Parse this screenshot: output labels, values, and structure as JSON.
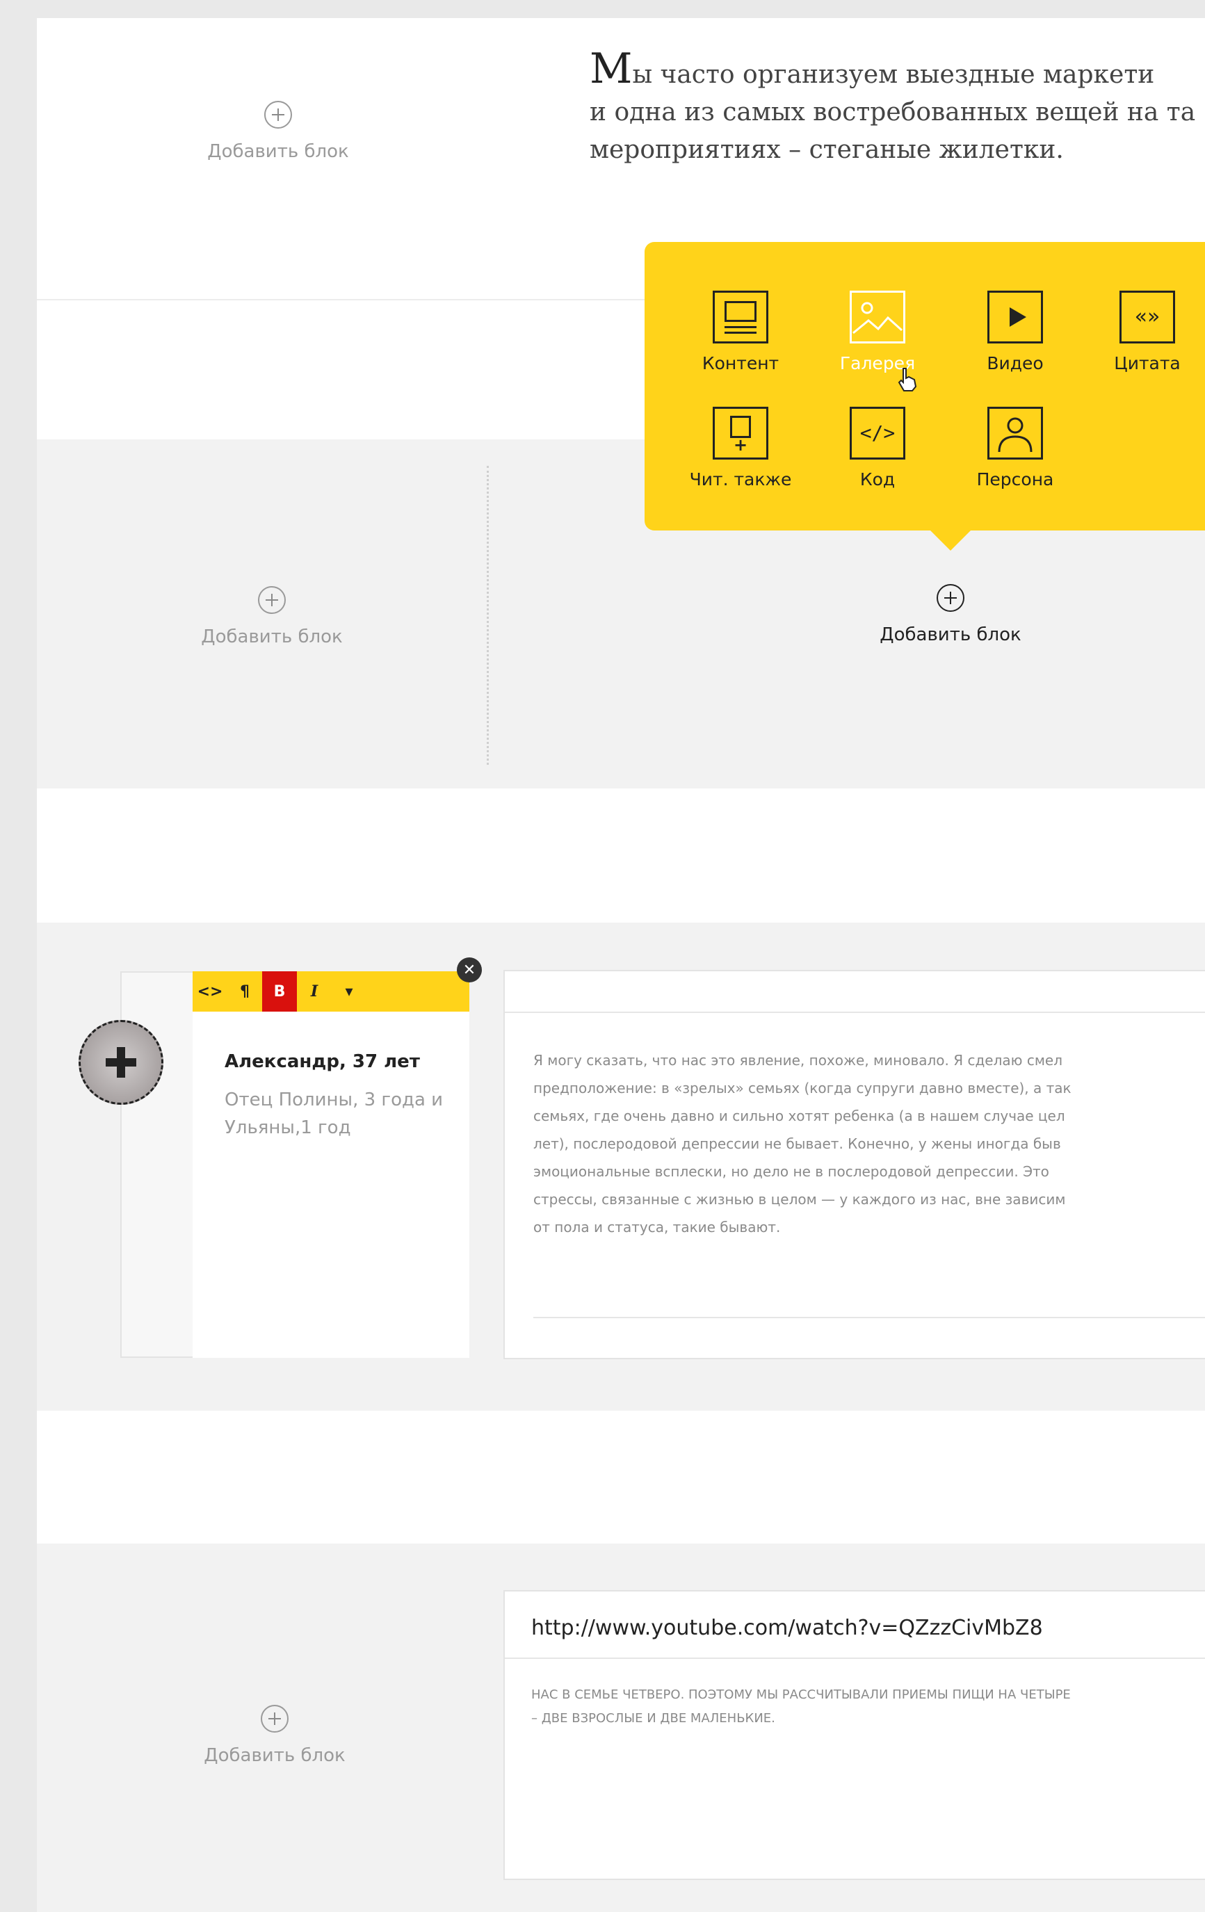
{
  "add_block_label": "Добавить блок",
  "intro": {
    "cap": "М",
    "line1": "ы часто организуем выездные маркети",
    "line2": "и одна из самых востребованных вещей на та",
    "line3": "мероприятиях – стеганые жилетки."
  },
  "popup": {
    "items": [
      {
        "label": "Контент",
        "icon": "content-icon"
      },
      {
        "label": "Галерея",
        "icon": "gallery-icon",
        "active": true
      },
      {
        "label": "Видео",
        "icon": "video-icon"
      },
      {
        "label": "Цитата",
        "icon": "quote-icon",
        "glyph": "«»"
      },
      {
        "label": "Чит. также",
        "icon": "read-also-icon"
      },
      {
        "label": "Код",
        "icon": "code-icon",
        "glyph": "</>"
      },
      {
        "label": "Персона",
        "icon": "person-icon"
      }
    ],
    "add_block_label": "Добавить блок"
  },
  "quote_card": {
    "toolbar": [
      "<>",
      "¶",
      "B",
      "I",
      "▾"
    ],
    "close": "✕",
    "person_name": "Александр, 37 лет",
    "person_desc": "Отец Полины, 3 года и Ульяны,1 год",
    "text": "Я могу сказать, что нас это явление, похоже, миновало. Я сделаю смел\nпредположение: в «зрелых» семьях (когда супруги давно вместе), а так\nсемьях, где очень давно и сильно хотят ребенка (а в нашем случае цел\nлет), послеродовой депрессии не бывает. Конечно, у жены иногда быв\nэмоциональные всплески, но дело не в послеродовой депрессии. Это\nстрессы, связанные с жизнью в целом — у каждого из нас, вне зависим\nот пола и статуса, такие бывают."
  },
  "video_block": {
    "url": "http://www.youtube.com/watch?v=QZzzCivMbZ8",
    "caption": "НАС В СЕМЬЕ ЧЕТВЕРО. ПОЭТОМУ МЫ РАССЧИТЫВАЛИ ПРИЕМЫ ПИЩИ НА ЧЕТЫРЕ\n– ДВЕ ВЗРОСЛЫЕ И ДВЕ МАЛЕНЬКИЕ."
  },
  "colors": {
    "accent_yellow": "#ffd31a",
    "active_red": "#d9110d",
    "background": "#e9e9e9",
    "section_grey": "#f2f2f2"
  }
}
